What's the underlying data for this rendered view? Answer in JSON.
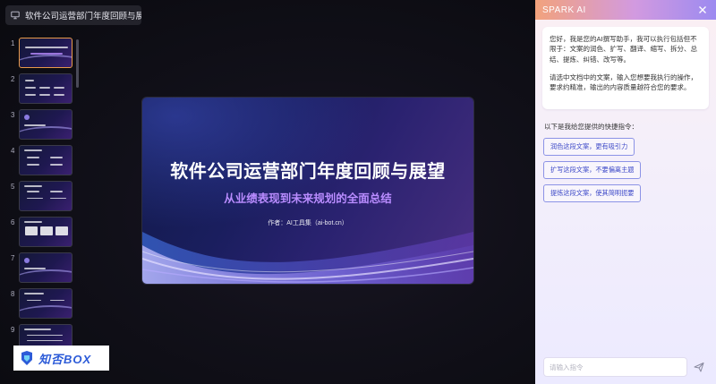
{
  "document": {
    "title": "软件公司运营部门年度回顾与展望",
    "icon": "presentation-icon"
  },
  "thumbnails": [
    {
      "number": "1",
      "active": true
    },
    {
      "number": "2",
      "active": false
    },
    {
      "number": "3",
      "active": false
    },
    {
      "number": "4",
      "active": false
    },
    {
      "number": "5",
      "active": false
    },
    {
      "number": "6",
      "active": false
    },
    {
      "number": "7",
      "active": false
    },
    {
      "number": "8",
      "active": false
    },
    {
      "number": "9",
      "active": false
    }
  ],
  "slide": {
    "title": "软件公司运营部门年度回顾与展望",
    "subtitle": "从业绩表现到未来规划的全面总结",
    "author": "作者：AI工具集（ai-bot.cn）"
  },
  "watermark": {
    "text": "知否BOX"
  },
  "ai_panel": {
    "title": "SPARK AI",
    "close_icon": "close-icon",
    "greeting": "您好，我是您的AI撰写助手，我可以执行包括但不限于：文案的润色、扩写、翻译、缩写、拆分、总结、提炼、纠错、改写等。",
    "instruction": "请选中文档中的文案，输入您想要我执行的操作，要求约精准，输出的内容质量越符合您的要求。",
    "shortcuts_label": "以下是我给您提供的快捷指令：",
    "shortcuts": [
      "润色这段文案，更有吸引力",
      "扩写这段文案，不要偏离主题",
      "提炼这段文案，使其简明扼要"
    ],
    "input_placeholder": "请输入指令",
    "send_icon": "send-icon"
  },
  "colors": {
    "accent": "#8c93e6",
    "active_thumb_border": "#e89a4a",
    "subtitle_purple": "#b98cff"
  }
}
